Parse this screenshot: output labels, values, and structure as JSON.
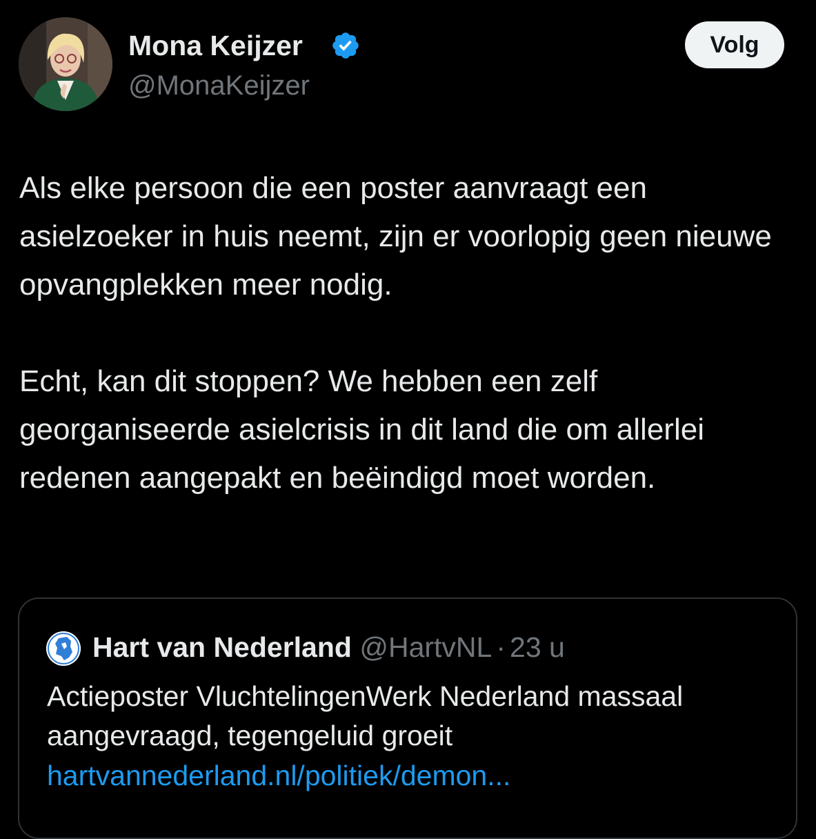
{
  "author": {
    "display_name": "Mona Keijzer",
    "handle": "@MonaKeijzer",
    "verified": true,
    "verified_color": "#1d9bf0",
    "avatar_icon": "profile-photo"
  },
  "follow_button": {
    "label": "Volg"
  },
  "tweet": {
    "paragraphs": [
      "Als elke persoon die een poster aanvraagt een asielzoeker in huis neemt, zijn er voorlopig geen nieuwe opvangplekken meer nodig.",
      "Echt, kan dit stoppen? We hebben een zelf georganiseerde asielcrisis in dit land die om allerlei redenen aangepakt en beëindigd moet worden."
    ]
  },
  "quoted_tweet": {
    "display_name": "Hart van Nederland",
    "handle": "@HartvNL",
    "separator": "·",
    "time": "23 u",
    "avatar_icon": "netherlands-map-logo",
    "text": "Actieposter VluchtelingenWerk Nederland massaal aangevraagd, tegengeluid groeit",
    "link": "hartvannederland.nl/politiek/demon..."
  },
  "colors": {
    "background": "#000000",
    "text_primary": "#e7e9ea",
    "text_secondary": "#71767b",
    "link": "#1d9bf0",
    "border": "#2f3336"
  }
}
